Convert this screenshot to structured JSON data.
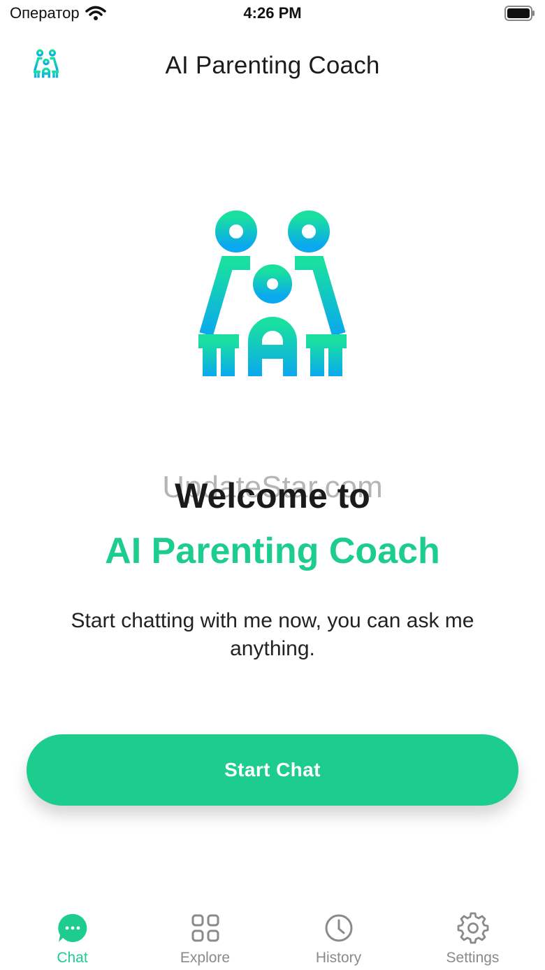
{
  "status_bar": {
    "carrier": "Оператор",
    "time": "4:26 PM"
  },
  "header": {
    "title": "AI Parenting Coach",
    "logo_icon": "family-icon"
  },
  "hero": {
    "icon": "family-icon"
  },
  "watermark": "UpdateStar.com",
  "welcome": {
    "line1": "Welcome to",
    "line2": "AI Parenting Coach",
    "subtitle": "Start chatting with me now, you can ask me anything."
  },
  "start_button": {
    "label": "Start Chat"
  },
  "tabs": [
    {
      "label": "Chat",
      "icon": "chat-bubble-icon",
      "active": true
    },
    {
      "label": "Explore",
      "icon": "grid-icon",
      "active": false
    },
    {
      "label": "History",
      "icon": "clock-icon",
      "active": false
    },
    {
      "label": "Settings",
      "icon": "gear-icon",
      "active": false
    }
  ],
  "colors": {
    "accent": "#1ccd8e",
    "gradient_top": "#19e0a0",
    "gradient_bottom": "#0aa8ee",
    "inactive": "#8a8a8a"
  }
}
